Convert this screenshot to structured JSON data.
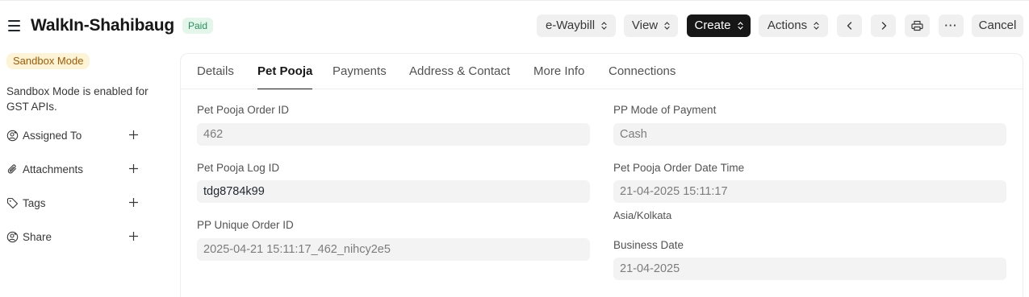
{
  "header": {
    "title": "WalkIn-Shahibaug",
    "status_badge": "Paid",
    "buttons": {
      "ewaybill": "e-Waybill",
      "view": "View",
      "create": "Create",
      "actions": "Actions",
      "more": "···",
      "cancel": "Cancel"
    }
  },
  "sidebar": {
    "sandbox_badge": "Sandbox Mode",
    "sandbox_text": "Sandbox Mode is enabled for GST APIs.",
    "items": [
      {
        "label": "Assigned To",
        "icon": "user-add-icon"
      },
      {
        "label": "Attachments",
        "icon": "paperclip-icon"
      },
      {
        "label": "Tags",
        "icon": "tag-icon"
      },
      {
        "label": "Share",
        "icon": "share-user-icon"
      }
    ]
  },
  "tabs": [
    "Details",
    "Pet Pooja",
    "Payments",
    "Address & Contact",
    "More Info",
    "Connections"
  ],
  "active_tab": "Pet Pooja",
  "form": {
    "left": [
      {
        "label": "Pet Pooja Order ID",
        "value": "462"
      },
      {
        "label": "Pet Pooja Log ID",
        "value": "tdg8784k99"
      },
      {
        "label": "PP Unique Order ID",
        "value": "2025-04-21 15:11:17_462_nihcy2e5"
      }
    ],
    "right": [
      {
        "label": "PP Mode of Payment",
        "value": "Cash"
      },
      {
        "label": "Pet Pooja Order Date Time",
        "value": "21-04-2025 15:11:17",
        "description": "Asia/Kolkata"
      },
      {
        "label": "Business Date",
        "value": "21-04-2025"
      }
    ]
  },
  "colors": {
    "primary_dark": "#171717",
    "paid_bg": "#e4f5e9",
    "paid_text": "#278f5e",
    "sandbox_bg": "#fdf3d6",
    "sandbox_text": "#a35a00"
  }
}
